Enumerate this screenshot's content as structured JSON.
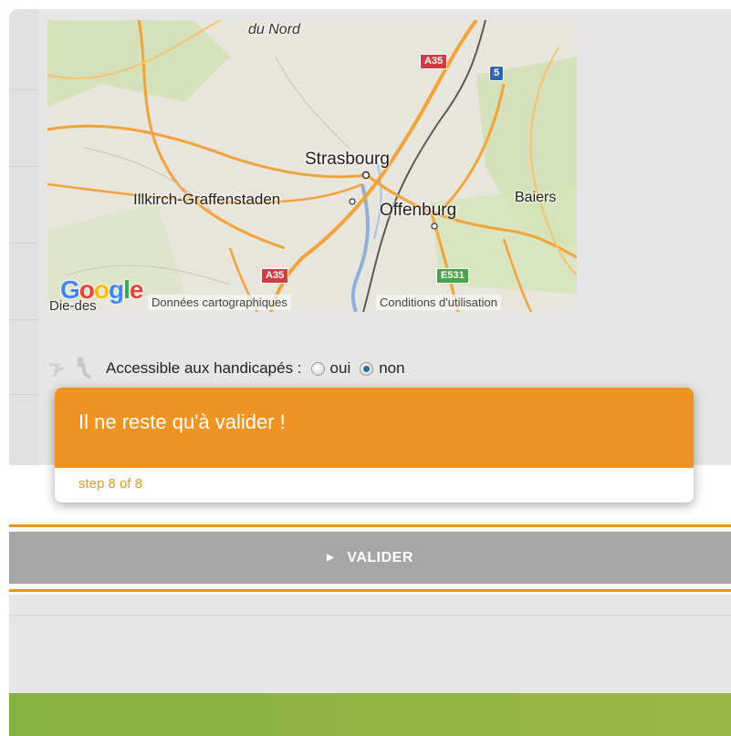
{
  "map": {
    "labels": {
      "vosges": "du Nord",
      "strasbourg": "Strasbourg",
      "illkirch": "Illkirch-Graffenstaden",
      "offenburg": "Offenburg",
      "baiers": "Baiers",
      "die_des": "Die-des"
    },
    "shields": {
      "a35_top": "A35",
      "a5": "5",
      "a35_bottom": "A35",
      "e531": "E531"
    },
    "google_logo": "Google",
    "attribution_data": "Données cartographiques",
    "attribution_terms": "Conditions d'utilisation"
  },
  "accessibility": {
    "label": "Accessible aux handicapés :",
    "option_yes": "oui",
    "option_no": "non",
    "selected": "non"
  },
  "tour": {
    "title": "Il ne reste qu'à valider !",
    "step": "step 8 of 8"
  },
  "validate_button": {
    "label": "VALIDER"
  },
  "colors": {
    "accent_orange": "#ef9323",
    "validate_gray": "#a6a6a6",
    "footer_green": "#8fb545"
  }
}
